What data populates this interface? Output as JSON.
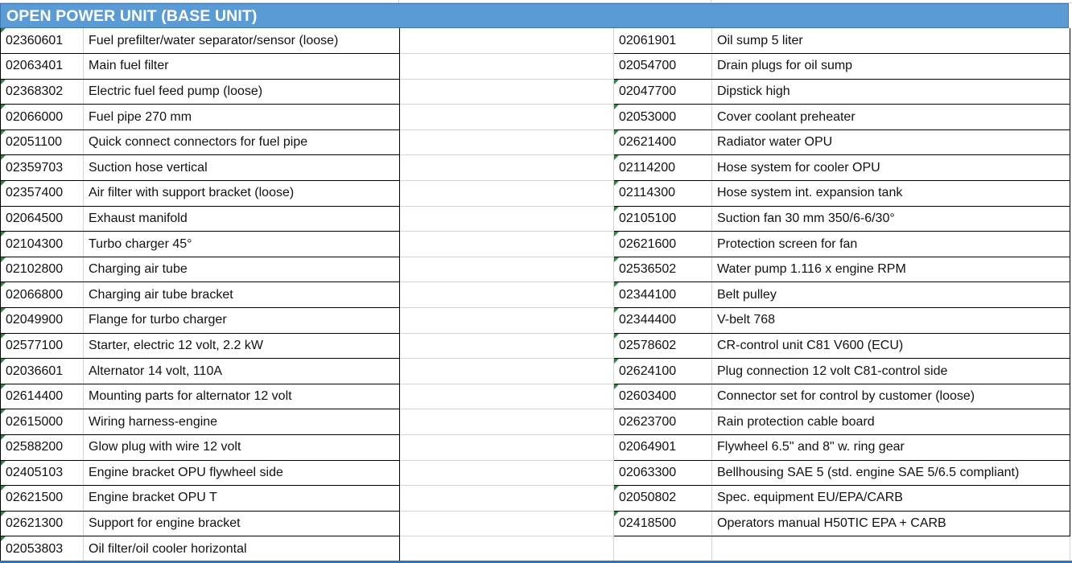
{
  "sheet": {
    "title": "OPEN POWER UNIT (BASE UNIT)",
    "colors": {
      "header_fill": "#5b9bd5",
      "header_text": "#ffffff",
      "flag": "#1e8e3e"
    },
    "left_rows": [
      {
        "code": "02360601",
        "desc": "Fuel prefilter/water separator/sensor (loose)",
        "flag": true
      },
      {
        "code": "02063401",
        "desc": "Main fuel filter",
        "flag": false
      },
      {
        "code": "02368302",
        "desc": "Electric fuel feed pump (loose)",
        "flag": true
      },
      {
        "code": "02066000",
        "desc": "Fuel pipe 270 mm",
        "flag": true
      },
      {
        "code": "02051100",
        "desc": "Quick connect connectors for fuel pipe",
        "flag": true
      },
      {
        "code": "02359703",
        "desc": "Suction hose vertical",
        "flag": true
      },
      {
        "code": "02357400",
        "desc": "Air filter with support bracket (loose)",
        "flag": true
      },
      {
        "code": "02064500",
        "desc": "Exhaust manifold",
        "flag": false
      },
      {
        "code": "02104300",
        "desc": "Turbo charger 45°",
        "flag": true
      },
      {
        "code": "02102800",
        "desc": "Charging air tube",
        "flag": true
      },
      {
        "code": "02066800",
        "desc": "Charging air tube bracket",
        "flag": true
      },
      {
        "code": "02049900",
        "desc": "Flange for turbo charger",
        "flag": true
      },
      {
        "code": "02577100",
        "desc": "Starter, electric 12 volt, 2.2 kW",
        "flag": true
      },
      {
        "code": "02036601",
        "desc": "Alternator 14 volt, 110A",
        "flag": true
      },
      {
        "code": "02614400",
        "desc": "Mounting parts for alternator 12 volt",
        "flag": true
      },
      {
        "code": "02615000",
        "desc": "Wiring harness-engine",
        "flag": true
      },
      {
        "code": "02588200",
        "desc": "Glow plug with wire 12 volt",
        "flag": true
      },
      {
        "code": "02405103",
        "desc": "Engine bracket OPU flywheel side",
        "flag": true
      },
      {
        "code": "02621500",
        "desc": "Engine bracket OPU T",
        "flag": true
      },
      {
        "code": "02621300",
        "desc": "Support for engine bracket",
        "flag": true
      },
      {
        "code": "02053803",
        "desc": "Oil filter/oil cooler horizontal",
        "flag": true
      }
    ],
    "right_rows": [
      {
        "code": "02061901",
        "desc": "Oil sump 5 liter",
        "flag": false
      },
      {
        "code": "02054700",
        "desc": "Drain plugs for oil sump",
        "flag": false
      },
      {
        "code": "02047700",
        "desc": "Dipstick high",
        "flag": true
      },
      {
        "code": "02053000",
        "desc": "Cover coolant preheater",
        "flag": true
      },
      {
        "code": "02621400",
        "desc": "Radiator water OPU",
        "flag": true
      },
      {
        "code": "02114200",
        "desc": "Hose system for cooler OPU",
        "flag": true
      },
      {
        "code": "02114300",
        "desc": "Hose system int. expansion tank",
        "flag": true
      },
      {
        "code": "02105100",
        "desc": "Suction fan 30 mm 350/6-6/30°",
        "flag": true
      },
      {
        "code": "02621600",
        "desc": "Protection screen for fan",
        "flag": true
      },
      {
        "code": "02536502",
        "desc": "Water pump 1.116 x engine RPM",
        "flag": true
      },
      {
        "code": "02344100",
        "desc": "Belt pulley",
        "flag": true
      },
      {
        "code": "02344400",
        "desc": "V-belt 768",
        "flag": true
      },
      {
        "code": "02578602",
        "desc": "CR-control unit C81 V600 (ECU)",
        "flag": true
      },
      {
        "code": "02624100",
        "desc": "Plug connection 12 volt C81-control side",
        "flag": true
      },
      {
        "code": "02603400",
        "desc": "Connector set for control by customer (loose)",
        "flag": true
      },
      {
        "code": "02623700",
        "desc": "Rain protection cable board",
        "flag": false
      },
      {
        "code": "02064901",
        "desc": "Flywheel 6.5\" and 8\" w. ring gear",
        "flag": false
      },
      {
        "code": "02063300",
        "desc": "Bellhousing SAE 5 (std. engine SAE 5/6.5 compliant)",
        "flag": false
      },
      {
        "code": "02050802",
        "desc": "Spec. equipment EU/EPA/CARB",
        "flag": true
      },
      {
        "code": "02418500",
        "desc": "Operators manual H50TIC EPA + CARB",
        "flag": true
      }
    ]
  }
}
